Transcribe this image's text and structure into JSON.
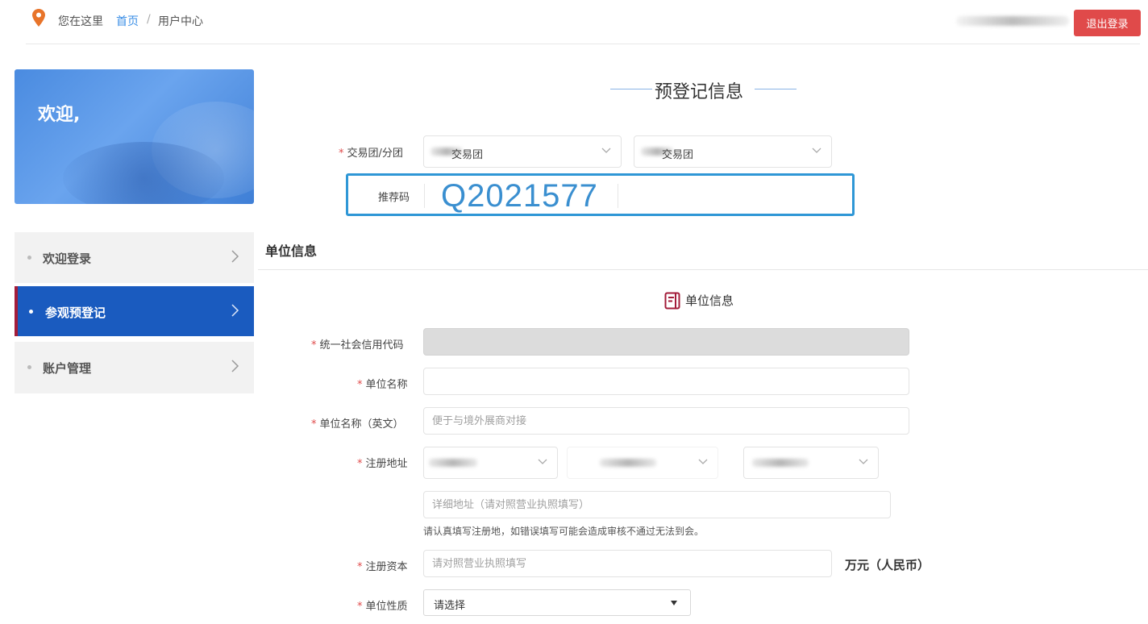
{
  "breadcrumb": {
    "prefix": "您在这里",
    "home": "首页",
    "separator": "/",
    "current": "用户中心"
  },
  "header": {
    "logout_label": "退出登录",
    "accent_color": "#e04a4a"
  },
  "sidebar": {
    "welcome": "欢迎,",
    "items": [
      {
        "label": "欢迎登录",
        "active": false
      },
      {
        "label": "参观预登记",
        "active": true
      },
      {
        "label": "账户管理",
        "active": false
      }
    ],
    "active_color": "#1a5bbf"
  },
  "main": {
    "title": "预登记信息",
    "group": {
      "label": "交易团/分团",
      "select1_value": "交易团",
      "select2_value": "交易团"
    },
    "referral": {
      "label": "推荐码",
      "code": "Q2021577"
    },
    "unit_section_title": "单位信息",
    "unit_subtitle": "单位信息",
    "fields": {
      "credit_code_label": "统一社会信用代码",
      "company_name_label": "单位名称",
      "company_name_en_label": "单位名称（英文）",
      "company_name_en_placeholder": "便于与境外展商对接",
      "address_label": "注册地址",
      "address_detail_placeholder": "详细地址（请对照营业执照填写）",
      "address_hint": "请认真填写注册地，如错误填写可能会造成审核不通过无法到会。",
      "capital_label": "注册资本",
      "capital_placeholder": "请对照营业执照填写",
      "capital_unit": "万元（人民币）",
      "nature_label": "单位性质",
      "nature_value": "请选择"
    }
  }
}
